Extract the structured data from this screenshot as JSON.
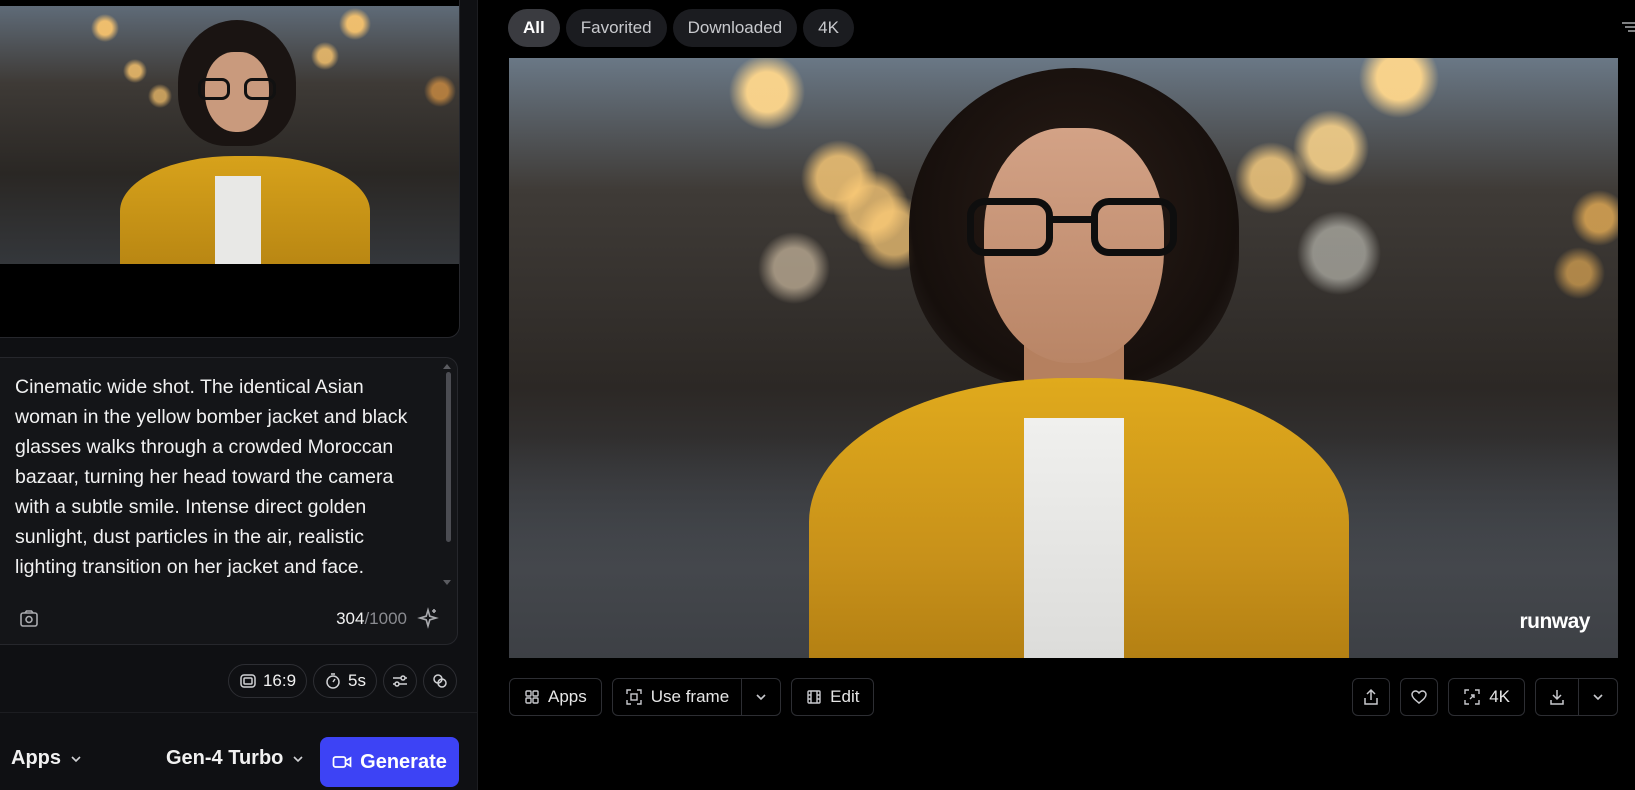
{
  "left_panel": {
    "prompt": {
      "text": "Cinematic wide shot. The identical Asian woman in the yellow bomber jacket and black glasses walks through a crowded Moroccan bazaar, turning her head toward the camera with a subtle smile. Intense direct golden sunlight, dust particles in the air, realistic lighting transition on her jacket and face.",
      "char_count": "304",
      "char_max": "/1000"
    },
    "chips": {
      "aspect_ratio": "16:9",
      "duration": "5s"
    },
    "bottom": {
      "apps_label": "Apps",
      "model_label": "Gen-4 Turbo",
      "generate_label": "Generate",
      "generate_color": "#3d43f5"
    }
  },
  "right_panel": {
    "tabs": [
      {
        "label": "All",
        "active": true
      },
      {
        "label": "Favorited",
        "active": false
      },
      {
        "label": "Downloaded",
        "active": false
      },
      {
        "label": "4K",
        "active": false
      }
    ],
    "watermark": "runway",
    "actions": {
      "apps_label": "Apps",
      "use_frame_label": "Use frame",
      "edit_label": "Edit",
      "upscale_label": "4K"
    }
  },
  "icons": {
    "image_ref": "image-reference-icon",
    "sparkle": "sparkle-icon",
    "aspect": "aspect-ratio-icon",
    "timer": "timer-icon",
    "settings": "sliders-icon",
    "link": "link-icon",
    "camera": "video-camera-icon",
    "grid": "grid-icon",
    "frame": "frame-icon",
    "film": "film-icon",
    "share": "share-icon",
    "heart": "heart-icon",
    "upscale": "upscale-icon",
    "download": "download-icon",
    "chevron": "chevron-down-icon",
    "sort": "sort-icon"
  }
}
